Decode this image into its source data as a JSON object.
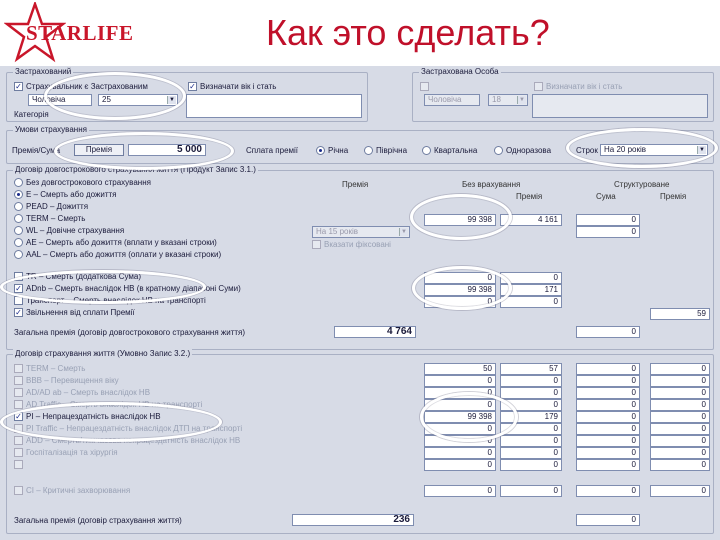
{
  "logo": {
    "text": "STARLIFE"
  },
  "slide": {
    "title": "Как это сделать?"
  },
  "insured": {
    "title": "Застрахований",
    "option1": "Страхувальник є Застрахованим",
    "option2": "Визначати вік і стать",
    "gender": "Чоловіча",
    "age": "25",
    "category_label": "Категорія"
  },
  "insured2": {
    "title": "Застрахована Особа",
    "option": "Визначати вік і стать",
    "gender": "Чоловіча",
    "age": "18"
  },
  "payment": {
    "title": "Умови страхування",
    "mode_label": "Премія/Сума",
    "mode_value": "Премія",
    "amount": "5 000",
    "frequency_label": "Сплата премії",
    "frequency": [
      "Річна",
      "Піврічна",
      "Квартальна",
      "Одноразова"
    ],
    "term_label": "Строк",
    "term_value": "На 20 років"
  },
  "life": {
    "title": "Договір довгострокового страхування життя (Продукт Запис 3.1.)",
    "col_premium": "Премія",
    "col_sum_insured": "Без врахування",
    "col_structured": "Структуроване",
    "col_sum": "Сума",
    "col_premium2": "Премія",
    "rows": [
      {
        "label": "Без довгострокового страхування",
        "type": "radio",
        "on": false
      },
      {
        "label": "E – Смерть або дожиття",
        "type": "radio",
        "on": true
      },
      {
        "label": "PEAD – Дожиття",
        "type": "radio",
        "on": false
      },
      {
        "label": "TERM – Смерть",
        "type": "radio",
        "on": false
      },
      {
        "label": "WL – Довічне страхування",
        "type": "radio",
        "on": false
      },
      {
        "label": "AE – Смерть або дожиття (вплати у вказані строки)",
        "type": "radio",
        "on": false
      },
      {
        "label": "AAL – Смерть або дожиття (оплати у вказані строки)",
        "type": "radio",
        "on": false
      },
      {
        "label": "TR – Смерть (додаткова Сума)",
        "type": "check",
        "on": false
      },
      {
        "label": "ADnb – Смерть внаслідок НВ (в кратному діапазоні Суми)",
        "type": "check",
        "on": true
      },
      {
        "label": "Транспорт – Смерть внаслідок НВ на транспорті",
        "type": "check",
        "on": false
      },
      {
        "label": "Звільнення від сплати Премії",
        "type": "check",
        "on": true
      }
    ],
    "term_select": "На 15 років",
    "term_check": "Вказати фіксовані",
    "e_sum": "99 398",
    "e_premium": "4 161",
    "e_zero": "0",
    "term_zero": "0",
    "tr_zero1": "0",
    "tr_zero2": "0",
    "ad_sum": "99 398",
    "ad_premium": "171",
    "ad_zero": "0",
    "transport_zero": "0",
    "waiver_value": "59",
    "total_label": "Загальна премія (договір довгострокового страхування життя)",
    "total_value": "4 764",
    "total_zero": "0"
  },
  "risk": {
    "title": "Договір страхування життя (Умовно Запис 3.2.)",
    "rows": [
      {
        "label": "TERM – Смерть",
        "on": false
      },
      {
        "label": "BBB – Перевищення віку",
        "on": false
      },
      {
        "label": "AD/AD ab – Смерть внаслідок НВ",
        "on": false
      },
      {
        "label": "AD Traffic – Смерть внаслідок НВ на транспорті",
        "on": false
      },
      {
        "label": "PI – Непрацездатність внаслідок НВ",
        "on": true
      },
      {
        "label": "PI Traffic – Непрацездатність внаслідок ДТП на транспорті",
        "on": false
      },
      {
        "label": "ADD – Смерть/тимчасова непрацездатність внаслідок НВ",
        "on": false
      },
      {
        "label": "Госпіталізація та хірургія",
        "on": false
      },
      {
        "label": "",
        "on": false
      },
      {
        "label": "CI – Критичні захворювання",
        "on": false
      }
    ],
    "term_values": [
      "50",
      "57"
    ],
    "pi_sum": "99 398",
    "pi_premium": "179",
    "zero": "0",
    "total_label": "Загальна премія (договір страхування життя)",
    "total_value": "236",
    "total_zero": "0"
  }
}
